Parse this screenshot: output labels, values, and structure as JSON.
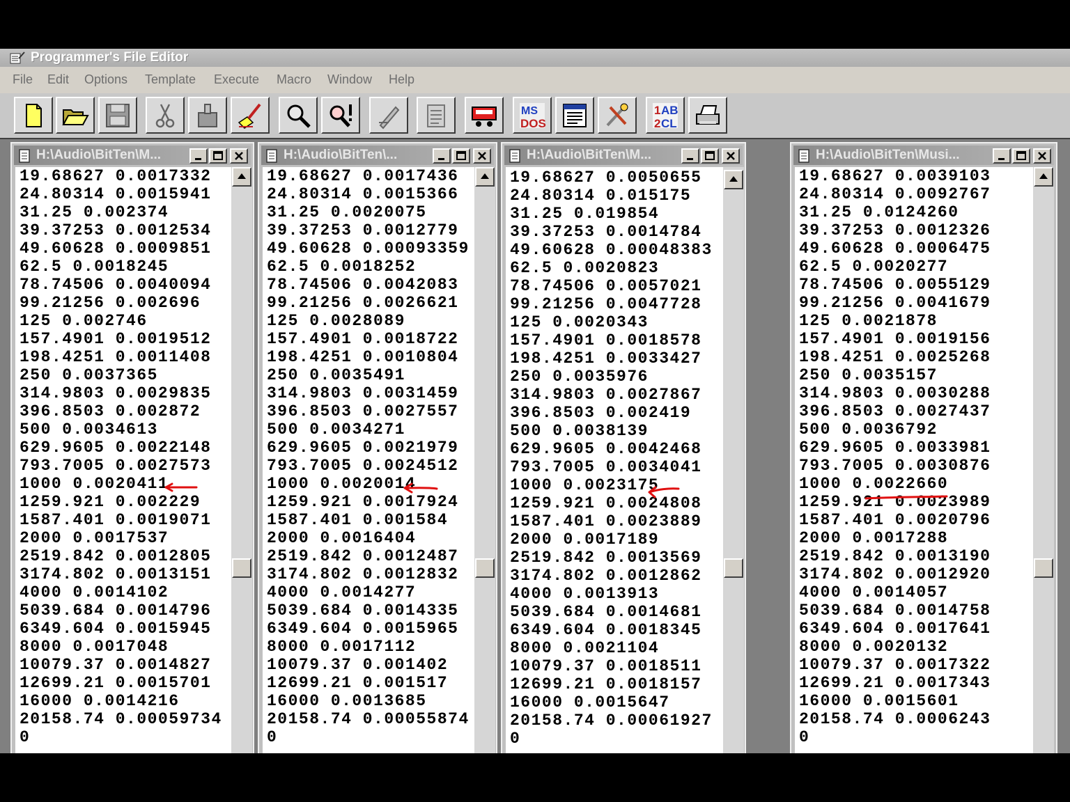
{
  "app": {
    "title": "Programmer's File Editor"
  },
  "menu": [
    "File",
    "Edit",
    "Options",
    "Template",
    "Execute",
    "Macro",
    "Window",
    "Help"
  ],
  "toolbar": [
    "new-file-icon",
    "open-folder-icon",
    "save-icon",
    "cut-icon",
    "paste-icon",
    "brush-icon",
    "search-icon",
    "find-next-icon",
    "edit-icon",
    "clipboard-icon",
    "tape-icon",
    "msdos-icon",
    "window-list-icon",
    "tools-icon",
    "abc-case-icon",
    "print-icon"
  ],
  "windows": [
    {
      "title": "H:\\Audio\\BitTen\\M...",
      "lines": [
        "19.68627 0.0017332",
        "24.80314 0.0015941",
        "31.25 0.002374",
        "39.37253 0.0012534",
        "49.60628 0.0009851",
        "62.5 0.0018245",
        "78.74506 0.0040094",
        "99.21256 0.002696",
        "125 0.002746",
        "157.4901 0.0019512",
        "198.4251 0.0011408",
        "250 0.0037365",
        "314.9803 0.0029835",
        "396.8503 0.002872",
        "500 0.0034613",
        "629.9605 0.0022148",
        "793.7005 0.0027573",
        "1000 0.0020411",
        "1259.921 0.002229",
        "1587.401 0.0019071",
        "2000 0.0017537",
        "2519.842 0.0012805",
        "3174.802 0.0013151",
        "4000 0.0014102",
        "5039.684 0.0014796",
        "6349.604 0.0015945",
        "8000 0.0017048",
        "10079.37 0.0014827",
        "12699.21 0.0015701",
        "16000 0.0014216",
        "20158.74 0.00059734",
        "0"
      ]
    },
    {
      "title": "H:\\Audio\\BitTen\\...",
      "lines": [
        "19.68627 0.0017436",
        "24.80314 0.0015366",
        "31.25 0.0020075",
        "39.37253 0.0012779",
        "49.60628 0.00093359",
        "62.5 0.0018252",
        "78.74506 0.0042083",
        "99.21256 0.0026621",
        "125 0.0028089",
        "157.4901 0.0018722",
        "198.4251 0.0010804",
        "250 0.0035491",
        "314.9803 0.0031459",
        "396.8503 0.0027557",
        "500 0.0034271",
        "629.9605 0.0021979",
        "793.7005 0.0024512",
        "1000 0.0020014",
        "1259.921 0.0017924",
        "1587.401 0.001584",
        "2000 0.0016404",
        "2519.842 0.0012487",
        "3174.802 0.0012832",
        "4000 0.0014277",
        "5039.684 0.0014335",
        "6349.604 0.0015965",
        "8000 0.0017112",
        "10079.37 0.001402",
        "12699.21 0.001517",
        "16000 0.0013685",
        "20158.74 0.00055874",
        "0"
      ]
    },
    {
      "title": "H:\\Audio\\BitTen\\M...",
      "lines": [
        "19.68627 0.0050655",
        "24.80314 0.015175",
        "31.25 0.019854",
        "39.37253 0.0014784",
        "49.60628 0.00048383",
        "62.5 0.0020823",
        "78.74506 0.0057021",
        "99.21256 0.0047728",
        "125 0.0020343",
        "157.4901 0.0018578",
        "198.4251 0.0033427",
        "250 0.0035976",
        "314.9803 0.0027867",
        "396.8503 0.002419",
        "500 0.0038139",
        "629.9605 0.0042468",
        "793.7005 0.0034041",
        "1000 0.0023175",
        "1259.921 0.0024808",
        "1587.401 0.0023889",
        "2000 0.0017189",
        "2519.842 0.0013569",
        "3174.802 0.0012862",
        "4000 0.0013913",
        "5039.684 0.0014681",
        "6349.604 0.0018345",
        "8000 0.0021104",
        "10079.37 0.0018511",
        "12699.21 0.0018157",
        "16000 0.0015647",
        "20158.74 0.00061927",
        "0"
      ]
    },
    {
      "title": "H:\\Audio\\BitTen\\Musi...",
      "lines": [
        "19.68627 0.0039103",
        "24.80314 0.0092767",
        "31.25 0.0124260",
        "39.37253 0.0012326",
        "49.60628 0.0006475",
        "62.5 0.0020277",
        "78.74506 0.0055129",
        "99.21256 0.0041679",
        "125 0.0021878",
        "157.4901 0.0019156",
        "198.4251 0.0025268",
        "250 0.0035157",
        "314.9803 0.0030288",
        "396.8503 0.0027437",
        "500 0.0036792",
        "629.9605 0.0033981",
        "793.7005 0.0030876",
        "1000 0.0022660",
        "1259.921 0.0023989",
        "1587.401 0.0020796",
        "2000 0.0017288",
        "2519.842 0.0013190",
        "3174.802 0.0012920",
        "4000 0.0014057",
        "5039.684 0.0014758",
        "6349.604 0.0017641",
        "8000 0.0020132",
        "10079.37 0.0017322",
        "12699.21 0.0017343",
        "16000 0.0015601",
        "20158.74 0.0006243",
        "0"
      ]
    }
  ]
}
